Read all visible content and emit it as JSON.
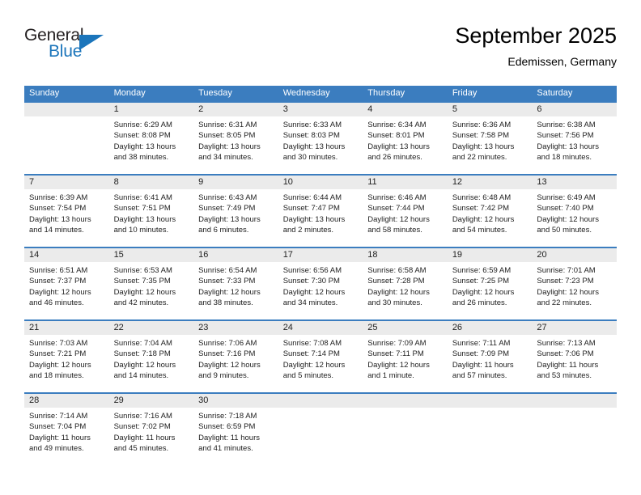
{
  "brand": {
    "name_part1": "General",
    "name_part2": "Blue",
    "triangle_icon": "triangle-icon",
    "accent_color": "#1b75bb"
  },
  "header": {
    "title": "September 2025",
    "location": "Edemissen, Germany"
  },
  "theme": {
    "header_blue": "#3b7dbf",
    "band_gray": "#ebebeb",
    "text": "#222222"
  },
  "weekdays": [
    "Sunday",
    "Monday",
    "Tuesday",
    "Wednesday",
    "Thursday",
    "Friday",
    "Saturday"
  ],
  "weeks": [
    [
      {
        "day": "",
        "sunrise": "",
        "sunset": "",
        "daylight_line1": "",
        "daylight_line2": ""
      },
      {
        "day": "1",
        "sunrise": "Sunrise: 6:29 AM",
        "sunset": "Sunset: 8:08 PM",
        "daylight_line1": "Daylight: 13 hours",
        "daylight_line2": "and 38 minutes."
      },
      {
        "day": "2",
        "sunrise": "Sunrise: 6:31 AM",
        "sunset": "Sunset: 8:05 PM",
        "daylight_line1": "Daylight: 13 hours",
        "daylight_line2": "and 34 minutes."
      },
      {
        "day": "3",
        "sunrise": "Sunrise: 6:33 AM",
        "sunset": "Sunset: 8:03 PM",
        "daylight_line1": "Daylight: 13 hours",
        "daylight_line2": "and 30 minutes."
      },
      {
        "day": "4",
        "sunrise": "Sunrise: 6:34 AM",
        "sunset": "Sunset: 8:01 PM",
        "daylight_line1": "Daylight: 13 hours",
        "daylight_line2": "and 26 minutes."
      },
      {
        "day": "5",
        "sunrise": "Sunrise: 6:36 AM",
        "sunset": "Sunset: 7:58 PM",
        "daylight_line1": "Daylight: 13 hours",
        "daylight_line2": "and 22 minutes."
      },
      {
        "day": "6",
        "sunrise": "Sunrise: 6:38 AM",
        "sunset": "Sunset: 7:56 PM",
        "daylight_line1": "Daylight: 13 hours",
        "daylight_line2": "and 18 minutes."
      }
    ],
    [
      {
        "day": "7",
        "sunrise": "Sunrise: 6:39 AM",
        "sunset": "Sunset: 7:54 PM",
        "daylight_line1": "Daylight: 13 hours",
        "daylight_line2": "and 14 minutes."
      },
      {
        "day": "8",
        "sunrise": "Sunrise: 6:41 AM",
        "sunset": "Sunset: 7:51 PM",
        "daylight_line1": "Daylight: 13 hours",
        "daylight_line2": "and 10 minutes."
      },
      {
        "day": "9",
        "sunrise": "Sunrise: 6:43 AM",
        "sunset": "Sunset: 7:49 PM",
        "daylight_line1": "Daylight: 13 hours",
        "daylight_line2": "and 6 minutes."
      },
      {
        "day": "10",
        "sunrise": "Sunrise: 6:44 AM",
        "sunset": "Sunset: 7:47 PM",
        "daylight_line1": "Daylight: 13 hours",
        "daylight_line2": "and 2 minutes."
      },
      {
        "day": "11",
        "sunrise": "Sunrise: 6:46 AM",
        "sunset": "Sunset: 7:44 PM",
        "daylight_line1": "Daylight: 12 hours",
        "daylight_line2": "and 58 minutes."
      },
      {
        "day": "12",
        "sunrise": "Sunrise: 6:48 AM",
        "sunset": "Sunset: 7:42 PM",
        "daylight_line1": "Daylight: 12 hours",
        "daylight_line2": "and 54 minutes."
      },
      {
        "day": "13",
        "sunrise": "Sunrise: 6:49 AM",
        "sunset": "Sunset: 7:40 PM",
        "daylight_line1": "Daylight: 12 hours",
        "daylight_line2": "and 50 minutes."
      }
    ],
    [
      {
        "day": "14",
        "sunrise": "Sunrise: 6:51 AM",
        "sunset": "Sunset: 7:37 PM",
        "daylight_line1": "Daylight: 12 hours",
        "daylight_line2": "and 46 minutes."
      },
      {
        "day": "15",
        "sunrise": "Sunrise: 6:53 AM",
        "sunset": "Sunset: 7:35 PM",
        "daylight_line1": "Daylight: 12 hours",
        "daylight_line2": "and 42 minutes."
      },
      {
        "day": "16",
        "sunrise": "Sunrise: 6:54 AM",
        "sunset": "Sunset: 7:33 PM",
        "daylight_line1": "Daylight: 12 hours",
        "daylight_line2": "and 38 minutes."
      },
      {
        "day": "17",
        "sunrise": "Sunrise: 6:56 AM",
        "sunset": "Sunset: 7:30 PM",
        "daylight_line1": "Daylight: 12 hours",
        "daylight_line2": "and 34 minutes."
      },
      {
        "day": "18",
        "sunrise": "Sunrise: 6:58 AM",
        "sunset": "Sunset: 7:28 PM",
        "daylight_line1": "Daylight: 12 hours",
        "daylight_line2": "and 30 minutes."
      },
      {
        "day": "19",
        "sunrise": "Sunrise: 6:59 AM",
        "sunset": "Sunset: 7:25 PM",
        "daylight_line1": "Daylight: 12 hours",
        "daylight_line2": "and 26 minutes."
      },
      {
        "day": "20",
        "sunrise": "Sunrise: 7:01 AM",
        "sunset": "Sunset: 7:23 PM",
        "daylight_line1": "Daylight: 12 hours",
        "daylight_line2": "and 22 minutes."
      }
    ],
    [
      {
        "day": "21",
        "sunrise": "Sunrise: 7:03 AM",
        "sunset": "Sunset: 7:21 PM",
        "daylight_line1": "Daylight: 12 hours",
        "daylight_line2": "and 18 minutes."
      },
      {
        "day": "22",
        "sunrise": "Sunrise: 7:04 AM",
        "sunset": "Sunset: 7:18 PM",
        "daylight_line1": "Daylight: 12 hours",
        "daylight_line2": "and 14 minutes."
      },
      {
        "day": "23",
        "sunrise": "Sunrise: 7:06 AM",
        "sunset": "Sunset: 7:16 PM",
        "daylight_line1": "Daylight: 12 hours",
        "daylight_line2": "and 9 minutes."
      },
      {
        "day": "24",
        "sunrise": "Sunrise: 7:08 AM",
        "sunset": "Sunset: 7:14 PM",
        "daylight_line1": "Daylight: 12 hours",
        "daylight_line2": "and 5 minutes."
      },
      {
        "day": "25",
        "sunrise": "Sunrise: 7:09 AM",
        "sunset": "Sunset: 7:11 PM",
        "daylight_line1": "Daylight: 12 hours",
        "daylight_line2": "and 1 minute."
      },
      {
        "day": "26",
        "sunrise": "Sunrise: 7:11 AM",
        "sunset": "Sunset: 7:09 PM",
        "daylight_line1": "Daylight: 11 hours",
        "daylight_line2": "and 57 minutes."
      },
      {
        "day": "27",
        "sunrise": "Sunrise: 7:13 AM",
        "sunset": "Sunset: 7:06 PM",
        "daylight_line1": "Daylight: 11 hours",
        "daylight_line2": "and 53 minutes."
      }
    ],
    [
      {
        "day": "28",
        "sunrise": "Sunrise: 7:14 AM",
        "sunset": "Sunset: 7:04 PM",
        "daylight_line1": "Daylight: 11 hours",
        "daylight_line2": "and 49 minutes."
      },
      {
        "day": "29",
        "sunrise": "Sunrise: 7:16 AM",
        "sunset": "Sunset: 7:02 PM",
        "daylight_line1": "Daylight: 11 hours",
        "daylight_line2": "and 45 minutes."
      },
      {
        "day": "30",
        "sunrise": "Sunrise: 7:18 AM",
        "sunset": "Sunset: 6:59 PM",
        "daylight_line1": "Daylight: 11 hours",
        "daylight_line2": "and 41 minutes."
      },
      {
        "day": "",
        "sunrise": "",
        "sunset": "",
        "daylight_line1": "",
        "daylight_line2": ""
      },
      {
        "day": "",
        "sunrise": "",
        "sunset": "",
        "daylight_line1": "",
        "daylight_line2": ""
      },
      {
        "day": "",
        "sunrise": "",
        "sunset": "",
        "daylight_line1": "",
        "daylight_line2": ""
      },
      {
        "day": "",
        "sunrise": "",
        "sunset": "",
        "daylight_line1": "",
        "daylight_line2": ""
      }
    ]
  ]
}
